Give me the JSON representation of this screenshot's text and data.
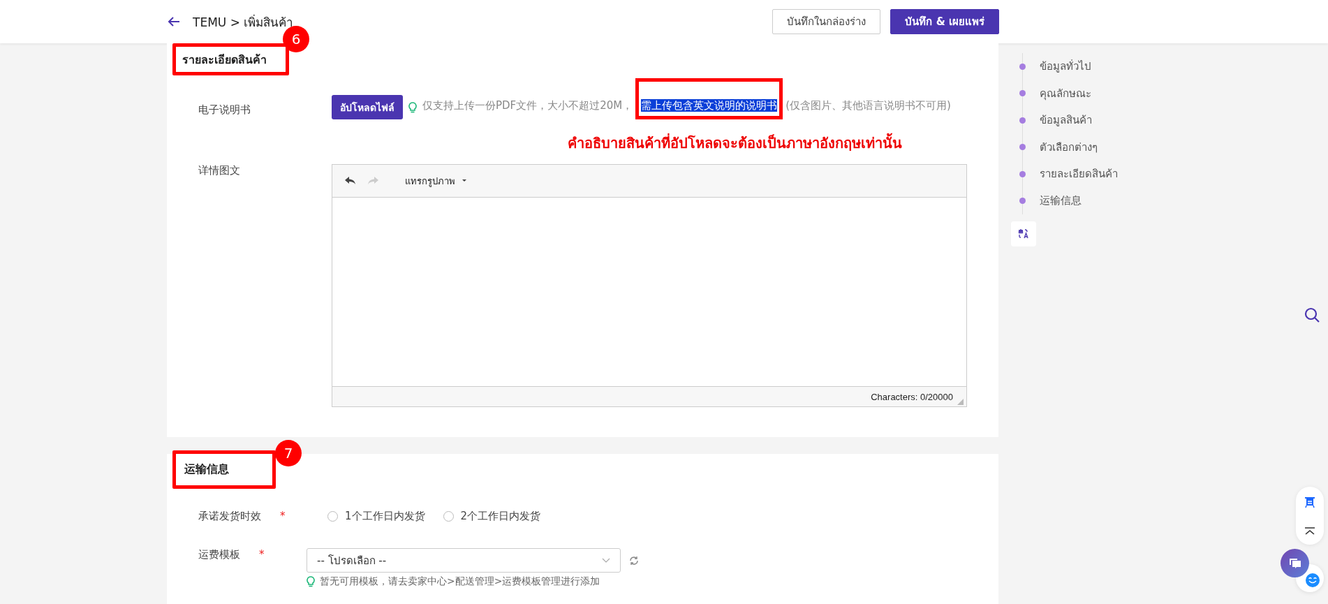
{
  "header": {
    "breadcrumb": "TEMU > เพิ่มสินค้า",
    "buttons": [
      {
        "label": "บันทึกในกล่องร่าง",
        "kind": "secondary"
      },
      {
        "label": "บันทึก & เผยแพร่",
        "kind": "primary"
      }
    ]
  },
  "product_details": {
    "title": "รายละเอียดสินค้า",
    "badge": "6",
    "manual": {
      "label": "电子说明书",
      "upload_button": "อัปโหลดไฟล์",
      "hint_before": "仅支持上传一份PDF文件，大小不超过20M，",
      "hint_highlighted": "需上传包含英文说明的说明书",
      "hint_after": "(仅含图片、其他语言说明书不可用)"
    },
    "annotation_note": "คำอธิบายสินค้าที่อัปโหลดจะต้องเป็นภาษาอังกฤษเท่านั้น",
    "detail": {
      "label": "详情图文",
      "toolbar": [
        {
          "kind": "undo",
          "disabled": false
        },
        {
          "kind": "redo",
          "disabled": true
        }
      ],
      "insert_menu": "แทรกรูปภาพ",
      "char_count": "Characters: 0/20000"
    }
  },
  "shipping": {
    "title": "运输信息",
    "badge": "7",
    "promise": {
      "label": "承诺发货时效",
      "required_mark": "*",
      "options": [
        {
          "label": "1个工作日内发货",
          "selected": false
        },
        {
          "label": "2个工作日内发货",
          "selected": false
        }
      ]
    },
    "template": {
      "label": "运费模板",
      "required_mark": "*",
      "placeholder": "-- โปรดเลือก --",
      "hint": "暂无可用模板，请去卖家中心>配送管理>运费模板管理进行添加"
    }
  },
  "sidebar": {
    "items": [
      "ข้อมูลทั่วไป",
      "คุณลักษณะ",
      "ข้อมูลสินค้า",
      "ตัวเลือกต่างๆ",
      "รายละเอียดสินค้า",
      "运输信息"
    ]
  }
}
